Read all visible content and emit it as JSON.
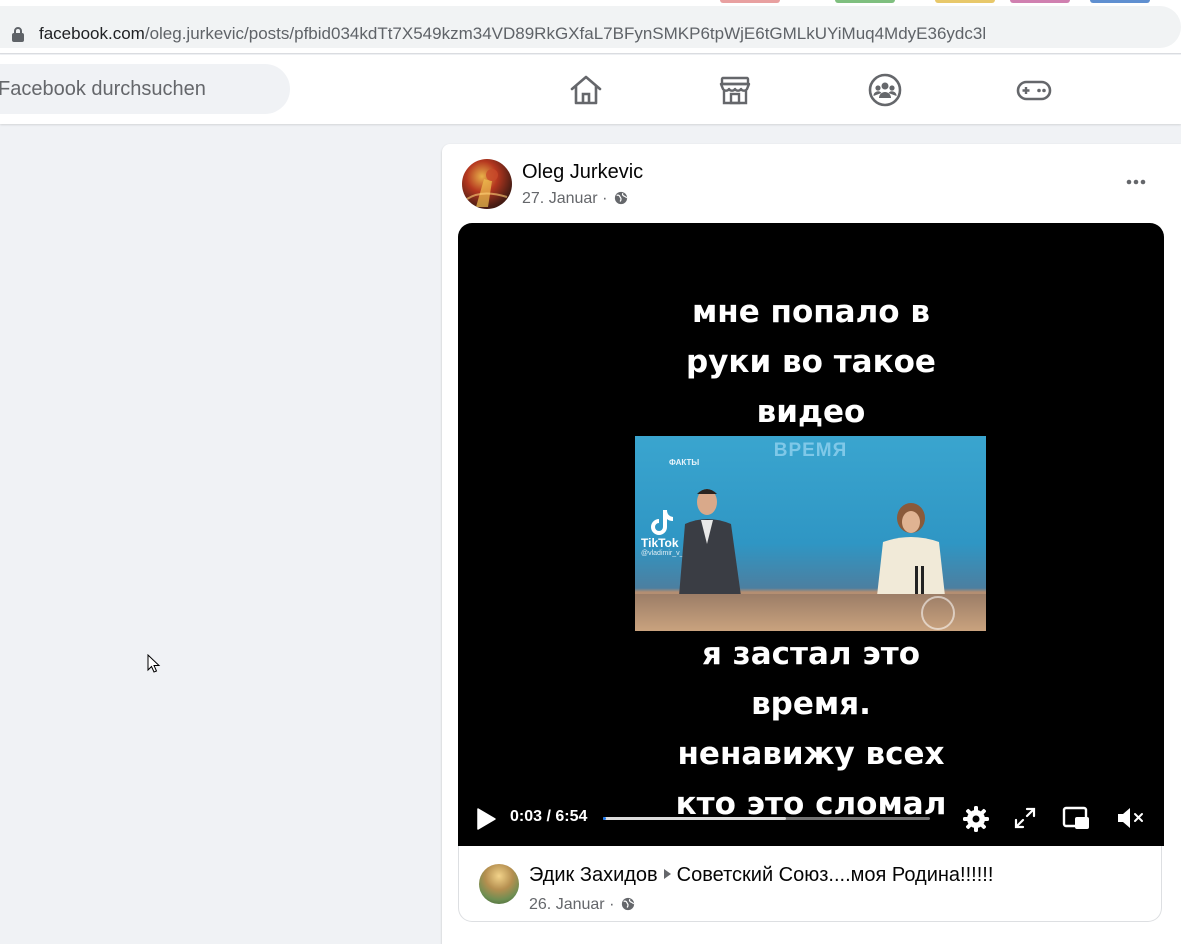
{
  "browser": {
    "url_host": "facebook.com",
    "url_path": "/oleg.jurkevic/posts/pfbid034kdTt7X549kzm34VD89RkGXfaL7BFynSMKP6tpWjE6tGMLkUYiMuq4MdyE36ydc3l"
  },
  "header": {
    "search_placeholder": "Facebook durchsuchen",
    "nav": [
      "home-icon",
      "marketplace-icon",
      "groups-icon",
      "gaming-icon"
    ]
  },
  "post": {
    "author": "Oleg Jurkevic",
    "date": "27. Januar",
    "separator": "·",
    "more_label": "•••",
    "video": {
      "caption_top": [
        "мне попало в",
        "руки во такое",
        "видео"
      ],
      "caption_bottom": [
        "я застал это",
        "время.",
        "ненавижу всех",
        "кто это сломал"
      ],
      "clip_title": "ВРЕМЯ",
      "clip_logo": "ФАКТЫ",
      "tiktok_label": "TikTok",
      "tiktok_handle": "@vladimir_v_k",
      "time_current": "0:03",
      "time_total": "6:54",
      "time_display": "0:03 / 6:54",
      "buffered_fraction": 0.56,
      "played_fraction": 0.008
    },
    "shared": {
      "author": "Эдик Захидов",
      "target": "Советский Союз....моя Родина!!!!!!",
      "date": "26. Januar",
      "separator": "·"
    }
  },
  "colors": {
    "fb_background": "#f0f2f5",
    "card": "#ffffff",
    "meta_text": "#65676b",
    "video_bg": "#000000"
  }
}
